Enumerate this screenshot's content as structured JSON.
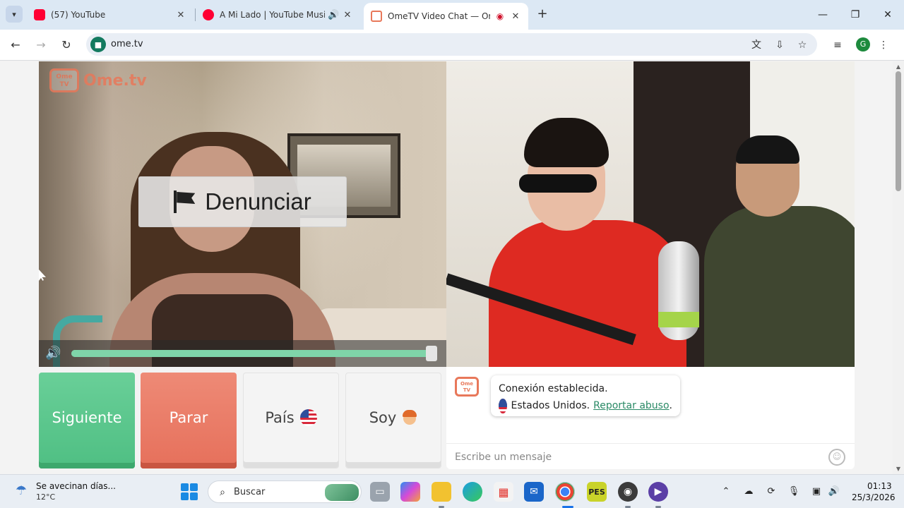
{
  "browser": {
    "tabs": [
      {
        "title": "(57) YouTube",
        "favicon_color": "#ff0033",
        "audio": false,
        "active": false
      },
      {
        "title": "A Mi Lado | YouTube Music",
        "favicon_color": "#ff0033",
        "audio": true,
        "active": false
      },
      {
        "title": "OmeTV Video Chat — Ome",
        "favicon_color": "#e8785a",
        "audio": false,
        "recording": true,
        "active": true
      }
    ],
    "address": "ome.tv",
    "profile_initial": "G"
  },
  "ometv": {
    "logo_badge": "Ome\nTV",
    "logo_text": "Ome.tv",
    "report_label": "Denunciar",
    "volume_percent": 100,
    "buttons": {
      "next": "Siguiente",
      "stop": "Parar",
      "country": "País",
      "gender": "Soy"
    },
    "chat": {
      "avatar_badge": "Ome\nTV",
      "message_line1": "Conexión establecida.",
      "country": "Estados Unidos.",
      "report_link": "Reportar abuso",
      "report_suffix": ".",
      "input_placeholder": "Escribe un mensaje"
    },
    "colors": {
      "next": "#58c48a",
      "stop": "#ea7a65",
      "accent": "#e8785a",
      "link": "#2a8a66"
    }
  },
  "taskbar": {
    "weather_title": "Se avecinan días...",
    "weather_temp": "12°C",
    "search_placeholder": "Buscar",
    "time": "01:13",
    "date": "25/3/2026",
    "apps": [
      "task-view",
      "copilot",
      "file-explorer",
      "edge",
      "store",
      "outlook",
      "chrome",
      "pes",
      "obs",
      "media-player"
    ]
  }
}
